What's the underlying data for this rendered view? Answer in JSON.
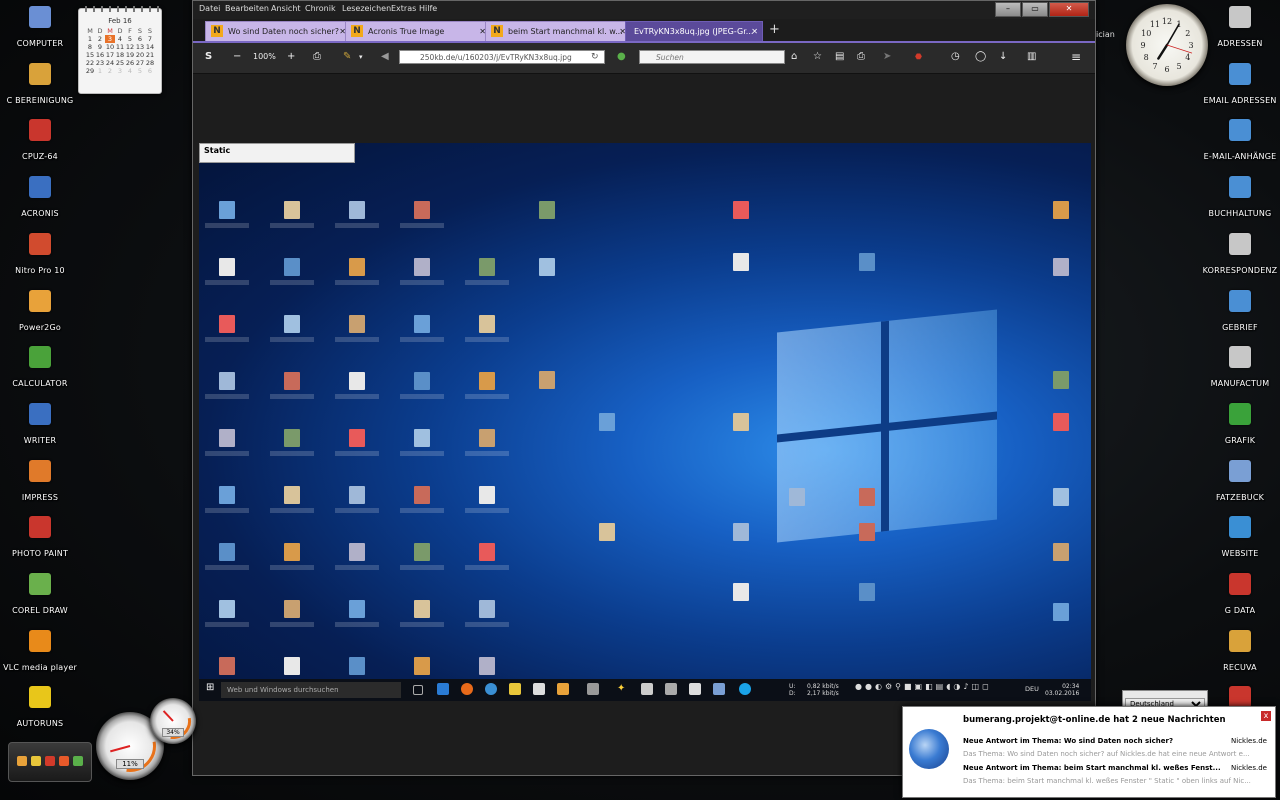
{
  "left_icons": [
    {
      "label": "COMPUTER",
      "icon": "computer-icon",
      "color": "#6a8fd4"
    },
    {
      "label": "C BEREINIGUNG",
      "icon": "cleanup-icon",
      "color": "#d9a23a"
    },
    {
      "label": "CPUZ-64",
      "icon": "cpuz-icon",
      "color": "#c9362d"
    },
    {
      "label": "ACRONIS",
      "icon": "acronis-icon",
      "color": "#3a6fc1"
    },
    {
      "label": "Nitro Pro 10",
      "icon": "nitro-icon",
      "color": "#d14b2e"
    },
    {
      "label": "Power2Go",
      "icon": "power2go-icon",
      "color": "#e8a23a"
    },
    {
      "label": "CALCULATOR",
      "icon": "calculator-icon",
      "color": "#4aa23a"
    },
    {
      "label": "WRITER",
      "icon": "writer-icon",
      "color": "#3a6fc1"
    },
    {
      "label": "IMPRESS",
      "icon": "impress-icon",
      "color": "#e07a2a"
    },
    {
      "label": "PHOTO PAINT",
      "icon": "photopaint-icon",
      "color": "#c9362d"
    },
    {
      "label": "COREL DRAW",
      "icon": "coreldraw-icon",
      "color": "#6ab04c"
    },
    {
      "label": "VLC media player",
      "icon": "vlc-icon",
      "color": "#e88a1a"
    },
    {
      "label": "AUTORUNS",
      "icon": "warning-icon",
      "color": "#e8c61a"
    }
  ],
  "right_icons": [
    {
      "label": "ADRESSEN",
      "icon": "addresses-icon",
      "color": "#c7c7c7"
    },
    {
      "label": "EMAIL ADRESSEN",
      "icon": "email-addresses-icon",
      "color": "#4a8fd4"
    },
    {
      "label": "E-MAIL-ANHÄNGE",
      "icon": "email-attachments-icon",
      "color": "#4a8fd4"
    },
    {
      "label": "BUCHHALTUNG",
      "icon": "accounting-icon",
      "color": "#4a8fd4"
    },
    {
      "label": "KORRESPONDENZ",
      "icon": "correspondence-icon",
      "color": "#c7c7c7"
    },
    {
      "label": "GEBRIEF",
      "icon": "letter-icon",
      "color": "#4a8fd4"
    },
    {
      "label": "MANUFACTUM",
      "icon": "manufactum-icon",
      "color": "#c7c7c7"
    },
    {
      "label": "GRAFIK",
      "icon": "graphics-icon",
      "color": "#3aa23a"
    },
    {
      "label": "FATZEBUCK",
      "icon": "people-icon",
      "color": "#7a9fd4"
    },
    {
      "label": "WEBSITE",
      "icon": "website-icon",
      "color": "#3a8fd4"
    },
    {
      "label": "G DATA",
      "icon": "gdata-icon",
      "color": "#c9362d"
    },
    {
      "label": "RECUVA",
      "icon": "recuva-icon",
      "color": "#d9a23a"
    },
    {
      "label": "",
      "icon": "pdf-icon",
      "color": "#c9362d"
    }
  ],
  "calendar": {
    "month": "Feb 16",
    "weekdays": [
      "M",
      "D",
      "M",
      "D",
      "F",
      "S",
      "S"
    ],
    "weeks": [
      [
        "1",
        "2",
        "3",
        "4",
        "5",
        "6",
        "7"
      ],
      [
        "8",
        "9",
        "10",
        "11",
        "12",
        "13",
        "14"
      ],
      [
        "15",
        "16",
        "17",
        "18",
        "19",
        "20",
        "21"
      ],
      [
        "22",
        "23",
        "24",
        "25",
        "26",
        "27",
        "28"
      ],
      [
        "29",
        "1",
        "2",
        "3",
        "4",
        "5",
        "6"
      ]
    ],
    "today": "3"
  },
  "clock": {
    "hour": 7,
    "minute": 5
  },
  "menubar": {
    "items": [
      "Datei",
      "Bearbeiten",
      "Ansicht",
      "Chronik",
      "Lesezeichen",
      "Extras",
      "Hilfe"
    ],
    "overflow_text": "ician"
  },
  "tabs": [
    {
      "title": "Wo sind Daten noch sicher?",
      "favicon": "N",
      "active": false
    },
    {
      "title": "Acronis True Image",
      "favicon": "N",
      "active": false
    },
    {
      "title": "beim Start manchmal kl. w...",
      "favicon": "N",
      "active": false
    },
    {
      "title": "EvTRyKN3x8uq.jpg (JPEG-Gr...",
      "favicon": "",
      "active": true
    }
  ],
  "toolbar": {
    "s_label": "S",
    "zoom": "100%",
    "url": "250kb.de/u/160203/j/EvTRyKN3x8uq.jpg",
    "search_placeholder": "Suchen"
  },
  "content": {
    "static_label": "Static"
  },
  "inner_taskbar": {
    "search_placeholder": "Web und Windows durchsuchen",
    "net_up": "U:",
    "net_down": "D:",
    "net_up_rate": "0,82 kbit/s",
    "net_down_rate": "2,17 kbit/s",
    "language": "DEU",
    "time": "02:34",
    "date": "03.02.2016"
  },
  "gauges": [
    {
      "name": "cpu-gauge",
      "percent": "11%",
      "value": 11
    },
    {
      "name": "memory-gauge",
      "percent": "34%",
      "value": 34
    }
  ],
  "language_select": {
    "value": "Deutschland"
  },
  "notification": {
    "title": "bumerang.projekt@t-online.de hat 2 neue Nachrichten",
    "items": [
      {
        "headline": "Neue Antwort im Thema: Wo sind Daten noch sicher?",
        "source": "Nickles.de",
        "snippet": "Das Thema: Wo sind Daten noch sicher? auf Nickles.de hat eine neue Antwort e..."
      },
      {
        "headline": "Neue Antwort im Thema: beim Start manchmal kl. weßes Fenst...",
        "source": "Nickles.de",
        "snippet": "Das Thema: beim Start manchmal kl. weßes Fenster \" Static \" oben links auf Nic..."
      }
    ],
    "close_label": "x"
  },
  "colors": {
    "tab_inactive": "#c8b6e8",
    "tab_active": "#5b4a9a",
    "accent": "#7a68c4"
  }
}
